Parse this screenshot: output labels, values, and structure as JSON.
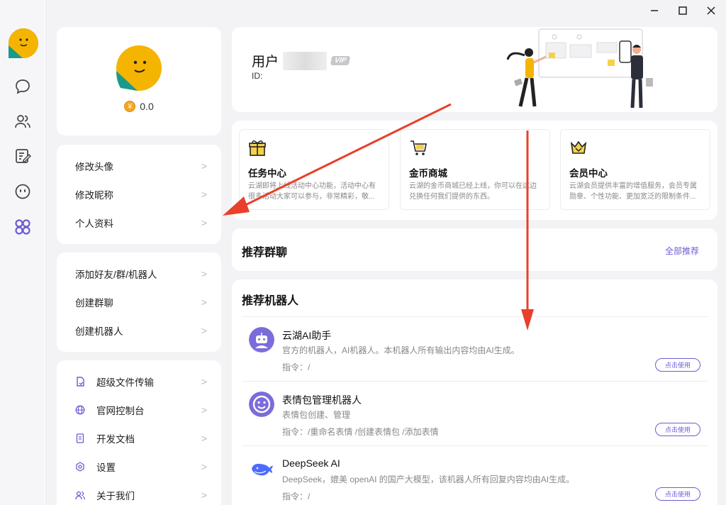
{
  "window_controls": [
    "minimize",
    "maximize",
    "close"
  ],
  "rail": {
    "items": [
      {
        "name": "chat",
        "icon": "chat-bubble-icon"
      },
      {
        "name": "contacts",
        "icon": "contacts-icon"
      },
      {
        "name": "notes",
        "icon": "edit-note-icon"
      },
      {
        "name": "bot",
        "icon": "bot-face-icon"
      },
      {
        "name": "apps",
        "icon": "apps-grid-icon",
        "active": true
      }
    ]
  },
  "profile": {
    "coins": "0.0"
  },
  "menu1": [
    {
      "label": "修改头像"
    },
    {
      "label": "修改昵称"
    },
    {
      "label": "个人资料"
    }
  ],
  "menu2": [
    {
      "label": "添加好友/群/机器人"
    },
    {
      "label": "创建群聊"
    },
    {
      "label": "创建机器人"
    }
  ],
  "menu3": [
    {
      "label": "超级文件传输",
      "icon": "file-transfer-icon"
    },
    {
      "label": "官网控制台",
      "icon": "globe-icon"
    },
    {
      "label": "开发文档",
      "icon": "document-icon"
    },
    {
      "label": "设置",
      "icon": "settings-gear-icon"
    },
    {
      "label": "关于我们",
      "icon": "about-users-icon"
    }
  ],
  "user": {
    "name_prefix": "用户",
    "vip": "VIP",
    "id_label": "ID:"
  },
  "features": [
    {
      "title": "任务中心",
      "desc": "云湖即将上线活动中心功能，活动中心有很多活动大家可以参与，非常精彩，敬...",
      "icon": "gift-icon"
    },
    {
      "title": "金币商城",
      "desc": "云湖的金币商城已经上线，你可以在这边兑换任何我们提供的东西。",
      "icon": "shopping-cart-icon"
    },
    {
      "title": "会员中心",
      "desc": "云湖会员提供丰富的增值服务，会员专属勋章、个性功能、更加宽泛的限制条件...",
      "icon": "crown-icon"
    }
  ],
  "groups": {
    "title": "推荐群聊",
    "all_link": "全部推荐"
  },
  "bots": {
    "title": "推荐机器人",
    "items": [
      {
        "name": "云湖AI助手",
        "desc": "官方的机器人，AI机器人。本机器人所有输出内容均由AI生成。",
        "cmd": "指令：/",
        "button": "点击使用"
      },
      {
        "name": "表情包管理机器人",
        "desc": "表情包创建、管理",
        "cmd": "指令：/重命名表情  /创建表情包  /添加表情",
        "button": "点击使用"
      },
      {
        "name": "DeepSeek AI",
        "desc": "DeepSeek，媲美 openAI 的国产大模型，该机器人所有回复内容均由AI生成。",
        "cmd": "指令：/",
        "button": "点击使用"
      }
    ]
  },
  "colors": {
    "accent": "#6b5dd3",
    "avatar_yellow": "#f5b400",
    "avatar_teal": "#1a9a8a",
    "arrow_red": "#e8402a"
  }
}
